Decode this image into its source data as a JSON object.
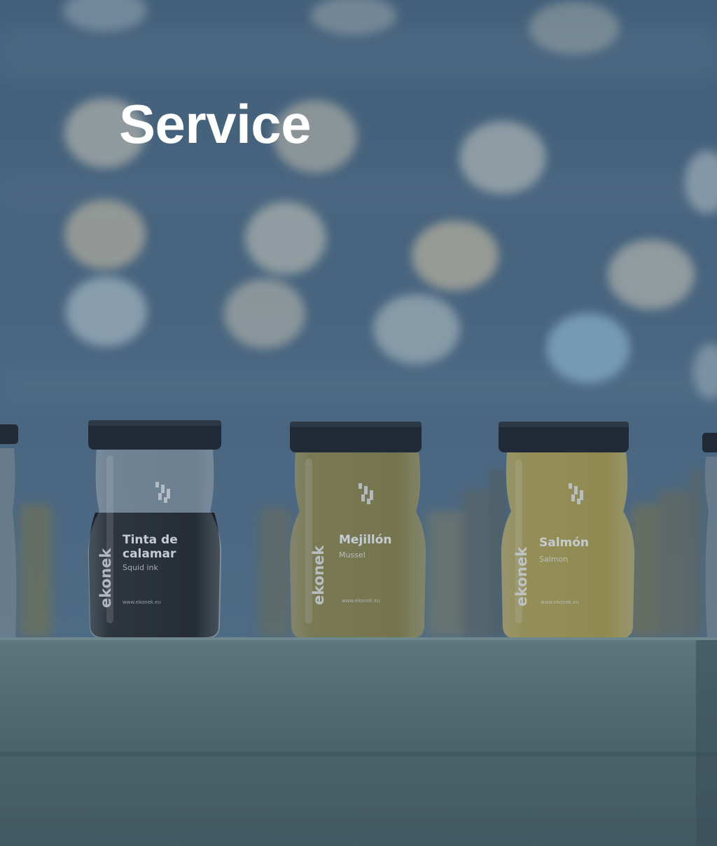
{
  "hero": {
    "title": "Service"
  },
  "jars": [
    {
      "brand": "ekonek",
      "name_line1": "Tinta de",
      "name_line2": "calamar",
      "subtitle": "Squid ink",
      "url": "www.ekonek.eu"
    },
    {
      "brand": "ekonek",
      "name_line1": "Mejillón",
      "name_line2": "",
      "subtitle": "Mussel",
      "url": "www.ekonek.eu"
    },
    {
      "brand": "ekonek",
      "name_line1": "Salmón",
      "name_line2": "",
      "subtitle": "Salmon",
      "url": "www.ekonek.eu"
    }
  ],
  "colors": {
    "overlay": "#2a4560",
    "bokeh_warm": "#e6dbc3",
    "bokeh_cool": "#aacde2",
    "shelf": "#5f7a76",
    "powder_black": "#141517",
    "powder_mussel": "#8a7f3a",
    "powder_salmon": "#b3a040",
    "lid": "#1c2228",
    "title_text": "#ffffff"
  }
}
